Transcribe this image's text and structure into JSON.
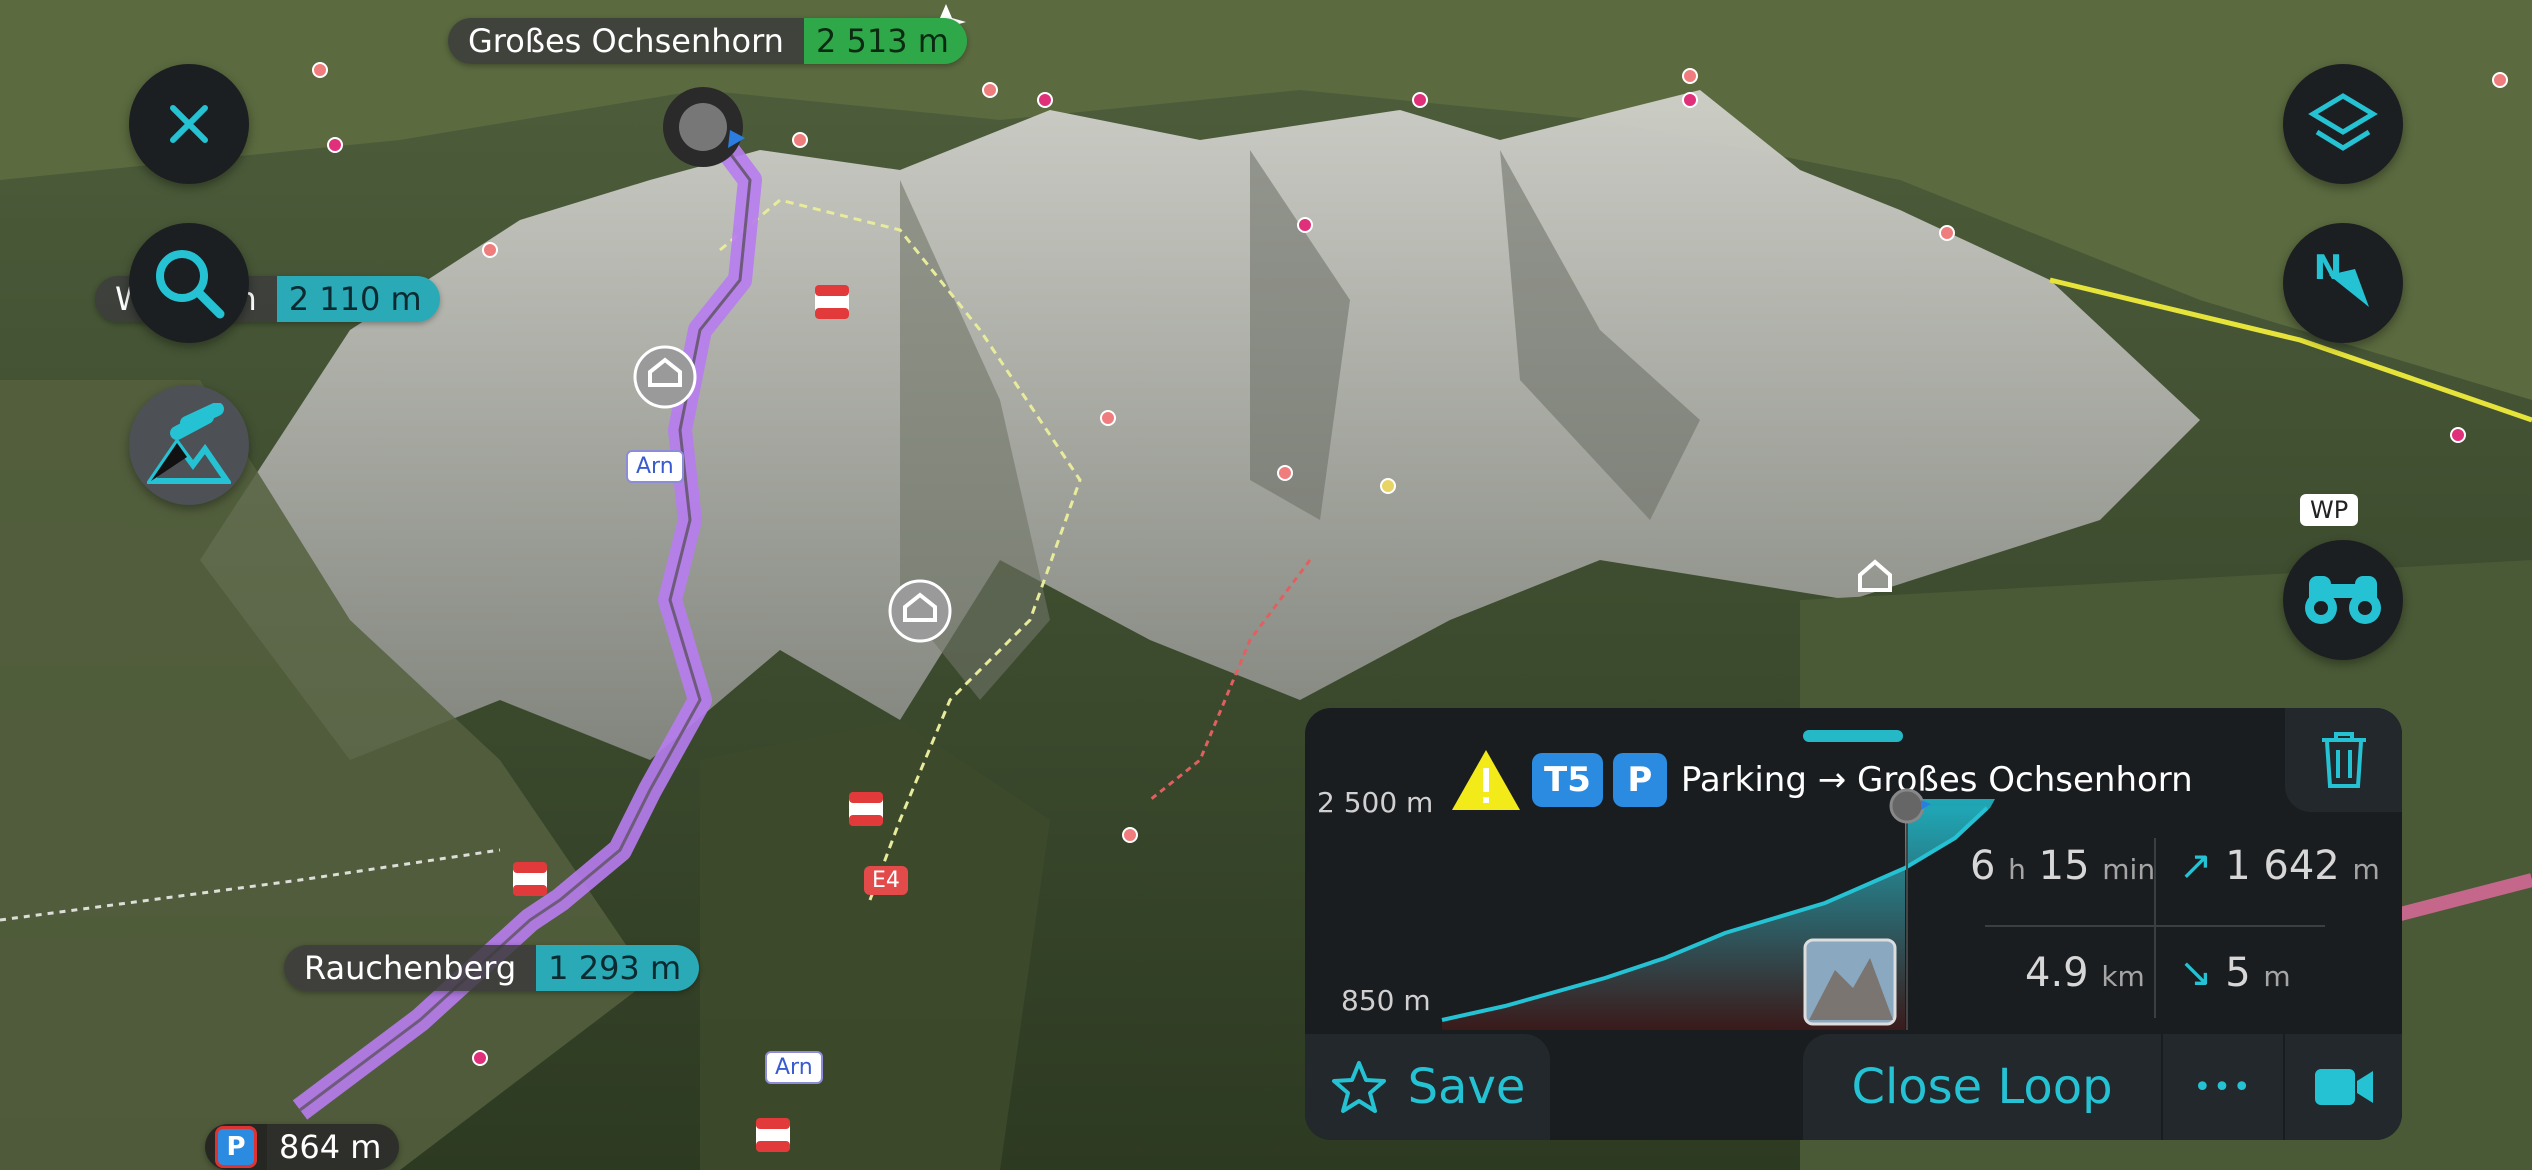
{
  "map_labels": {
    "summit": {
      "name": "Großes Ochsenhorn",
      "alt": "2 513 m"
    },
    "peak_left": {
      "name": "Wildhorn",
      "alt": "2 110 m"
    },
    "rauchenberg": {
      "name": "Rauchenberg",
      "alt": "1 293 m"
    },
    "parking": {
      "alt": "864 m"
    },
    "trail_tag_1": "Arn",
    "trail_tag_2": "Arn",
    "route_tag": "E4",
    "wp_tag": "WP"
  },
  "buttons": {
    "close": "close-icon",
    "search": "search-icon",
    "terrain": "terrain-icon",
    "layers": "layers-icon",
    "compass": "compass-icon",
    "compass_letter": "N",
    "binoculars": "binoculars-icon"
  },
  "route_panel": {
    "difficulty": "T5",
    "parking_badge": "P",
    "title": "Parking → Großes Ochsenhorn",
    "elev_max": "2 500 m",
    "elev_min": "850 m",
    "duration_h": "6",
    "duration_h_unit": "h",
    "duration_min": "15",
    "duration_min_unit": "min",
    "ascent": "1 642",
    "ascent_unit": "m",
    "distance": "4.9",
    "distance_unit": "km",
    "descent": "5",
    "descent_unit": "m",
    "save_label": "Save",
    "close_loop_label": "Close Loop",
    "more_label": "•••"
  },
  "colors": {
    "accent": "#25c2d3",
    "route": "#b77cf0",
    "badge_blue": "#2b8be0",
    "panel_bg": "#1a1d20"
  }
}
